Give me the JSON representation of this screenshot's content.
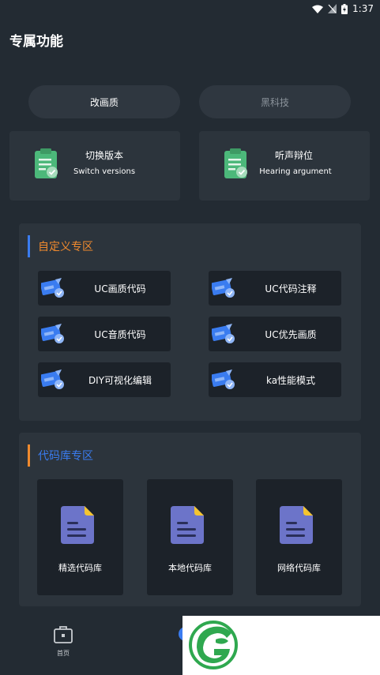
{
  "status_bar": {
    "time": "1:37"
  },
  "page": {
    "title": "专属功能"
  },
  "tabs": [
    {
      "label": "改画质",
      "active": true
    },
    {
      "label": "黑科技",
      "active": false
    }
  ],
  "features": [
    {
      "title": "切换版本",
      "subtitle": "Switch versions",
      "icon": "clipboard-check-icon"
    },
    {
      "title": "听声辩位",
      "subtitle": "Hearing argument",
      "icon": "clipboard-check-icon"
    }
  ],
  "custom_section": {
    "title": "自定义专区",
    "title_color": "#f08a2e",
    "items": [
      {
        "label": "UC画质代码",
        "icon": "ticket-edit-icon"
      },
      {
        "label": "UC代码注释",
        "icon": "ticket-edit-icon"
      },
      {
        "label": "UC音质代码",
        "icon": "ticket-edit-icon"
      },
      {
        "label": "UC优先画质",
        "icon": "ticket-edit-icon"
      },
      {
        "label": "DIY可视化编辑",
        "icon": "ticket-edit-icon"
      },
      {
        "label": "ka性能模式",
        "icon": "ticket-edit-icon"
      }
    ]
  },
  "library_section": {
    "title": "代码库专区",
    "title_color": "#3a7cf0",
    "items": [
      {
        "label": "精选代码库",
        "icon": "document-icon"
      },
      {
        "label": "本地代码库",
        "icon": "document-icon"
      },
      {
        "label": "网络代码库",
        "icon": "document-icon"
      }
    ]
  },
  "bottom_nav": {
    "home_label": "首页"
  },
  "colors": {
    "background": "#232b33",
    "card": "#2c343c",
    "button": "#1c2229",
    "accent_blue": "#3a7cf0",
    "accent_orange": "#f08a2e",
    "icon_green": "#4cb87a",
    "doc_purple": "#6c74c9",
    "doc_yellow": "#f4c430"
  }
}
